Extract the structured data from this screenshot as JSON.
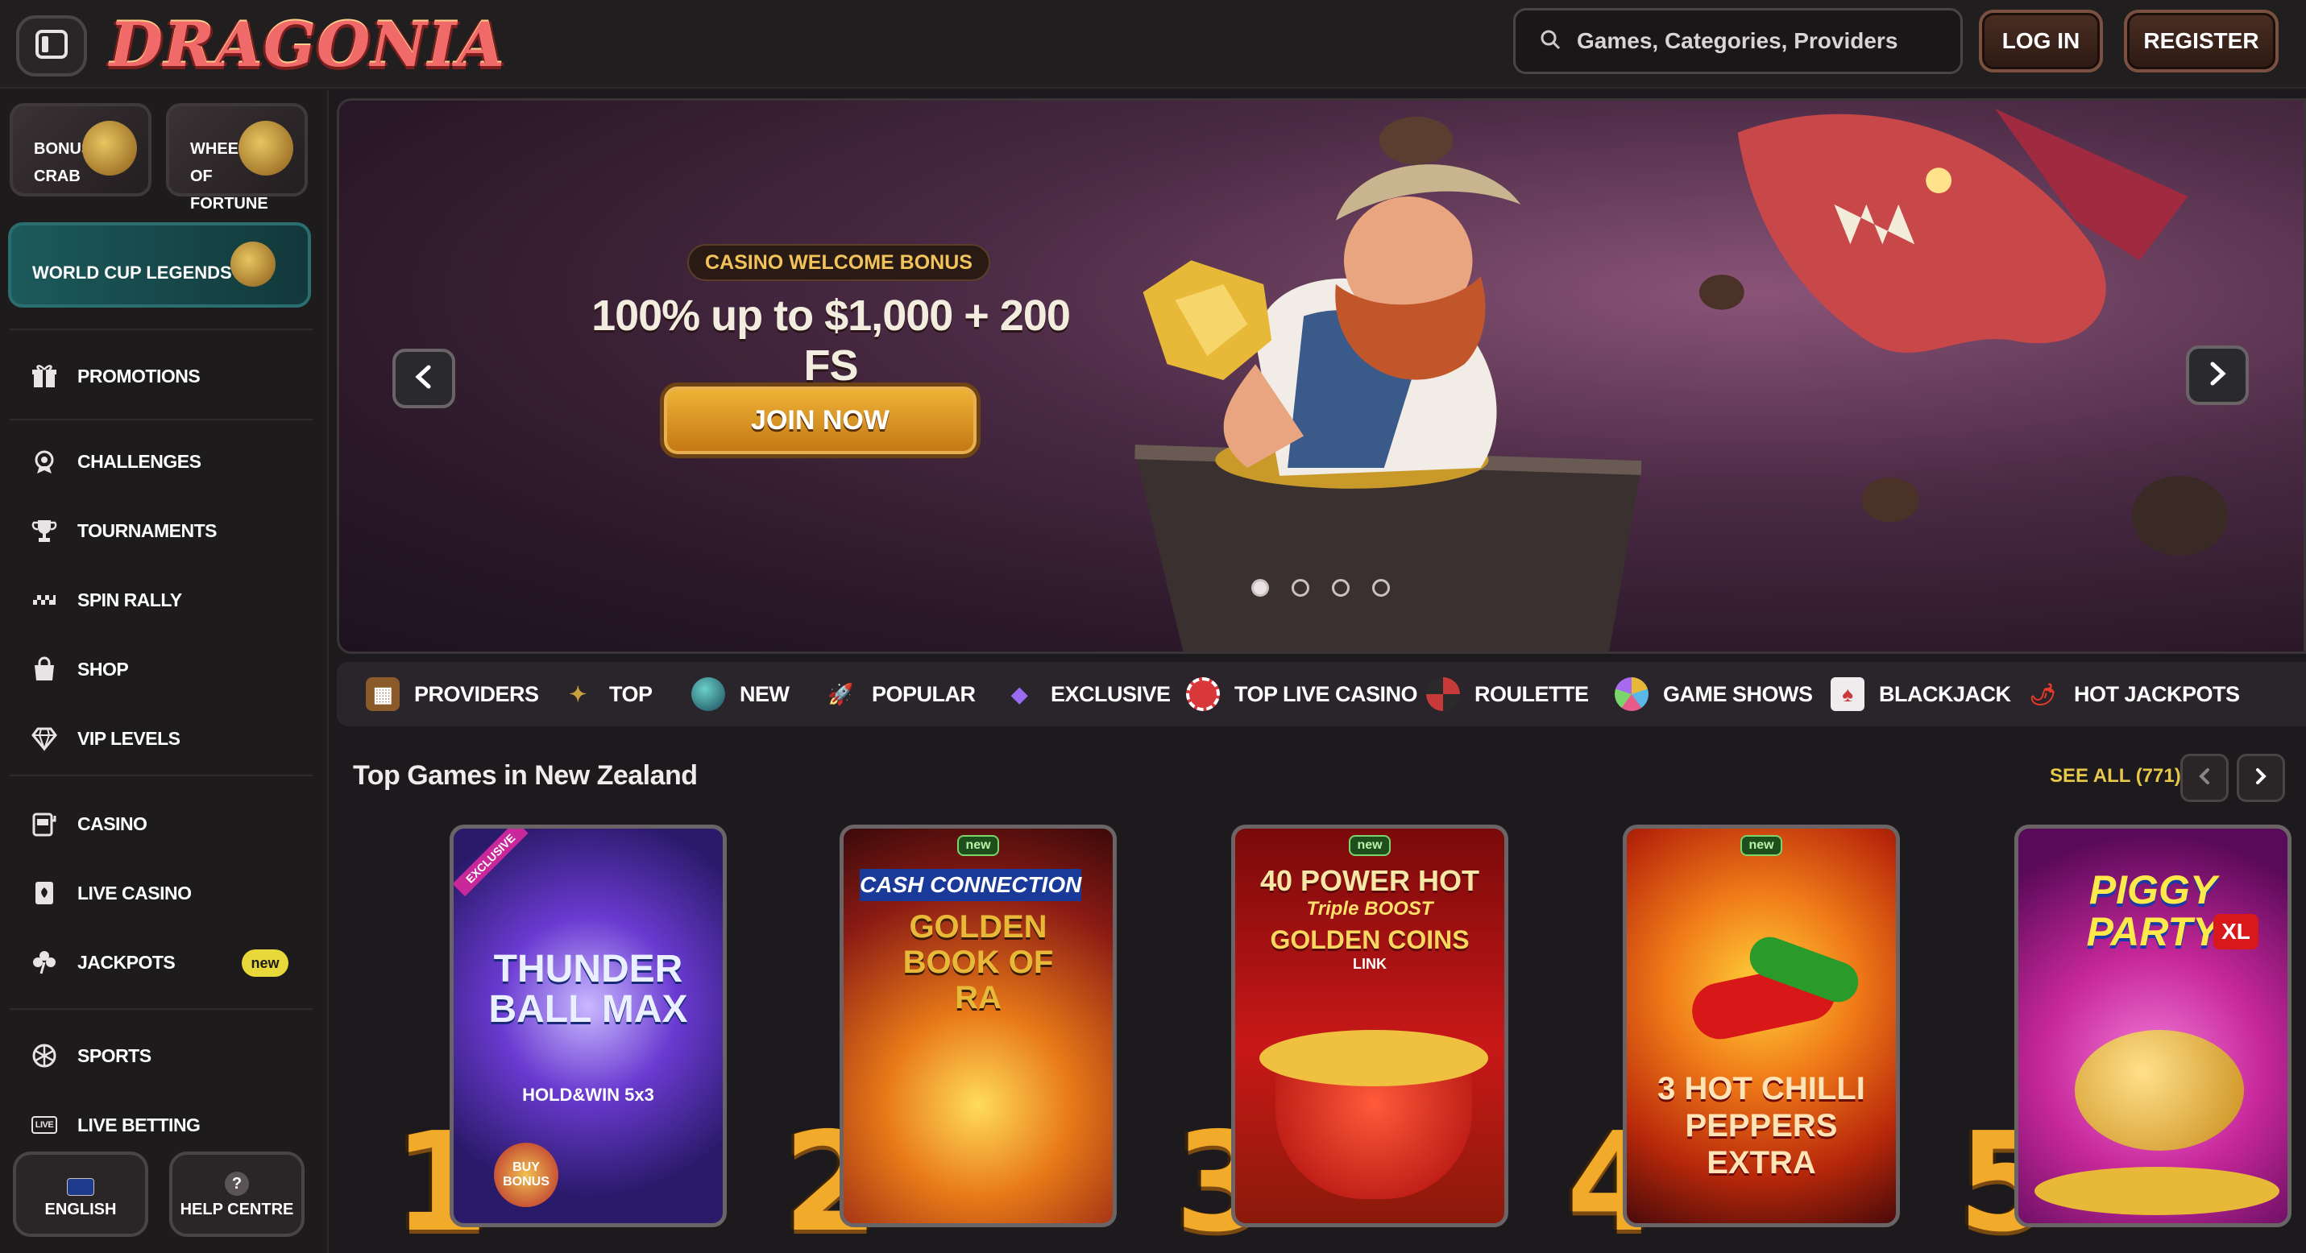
{
  "header": {
    "logo_text": "DRAGONIA",
    "search_placeholder": "Games, Categories, Providers",
    "login_label": "LOG IN",
    "register_label": "REGISTER"
  },
  "sidebar": {
    "tiles": {
      "bonus_crab": "BONUS CRAB",
      "wheel_of_fortune": "WHEEL OF FORTUNE",
      "world_cup": "WORLD CUP LEGENDS"
    },
    "nav": {
      "promotions": "PROMOTIONS",
      "challenges": "CHALLENGES",
      "tournaments": "TOURNAMENTS",
      "spin_rally": "SPIN RALLY",
      "shop": "SHOP",
      "vip_levels": "VIP LEVELS",
      "casino": "CASINO",
      "live_casino": "LIVE CASINO",
      "jackpots": "JACKPOTS",
      "jackpots_badge": "new",
      "sports": "SPORTS",
      "live_betting": "LIVE BETTING",
      "live_icon_text": "LIVE"
    },
    "language_label": "ENGLISH",
    "help_label": "HELP CENTRE"
  },
  "banner": {
    "tag": "CASINO WELCOME BONUS",
    "headline": "100% up to $1,000 + 200 FS",
    "cta": "JOIN NOW",
    "slides_total": 4,
    "active_slide": 1
  },
  "categories": {
    "providers": "PROVIDERS",
    "top": "TOP",
    "new": "NEW",
    "popular": "POPULAR",
    "exclusive": "EXCLUSIVE",
    "top_live_casino": "TOP LIVE CASINO",
    "roulette": "ROULETTE",
    "game_shows": "GAME SHOWS",
    "blackjack": "BLACKJACK",
    "hot_jackpots": "HOT JACKPOTS"
  },
  "top_games": {
    "title": "Top Games in New Zealand",
    "see_all": "SEE ALL (771)",
    "games": [
      {
        "rank": "1",
        "name": "THUNDER BALL MAX",
        "subtitle": "HOLD&WIN 5x3",
        "tag": "EXCLUSIVE",
        "extra": "BUY BONUS"
      },
      {
        "rank": "2",
        "name": "GOLDEN BOOK OF RA",
        "subtitle": "CASH CONNECTION",
        "tag": "new"
      },
      {
        "rank": "3",
        "name": "40 POWER HOT",
        "subtitle": "Triple BOOST",
        "extra": "GOLDEN COINS",
        "extra2": "LINK",
        "tag": "new"
      },
      {
        "rank": "4",
        "name": "3 HOT CHILLI PEPPERS EXTRA",
        "tag": "new"
      },
      {
        "rank": "5",
        "name": "PIGGY PARTY",
        "subtitle": "XL"
      }
    ]
  }
}
